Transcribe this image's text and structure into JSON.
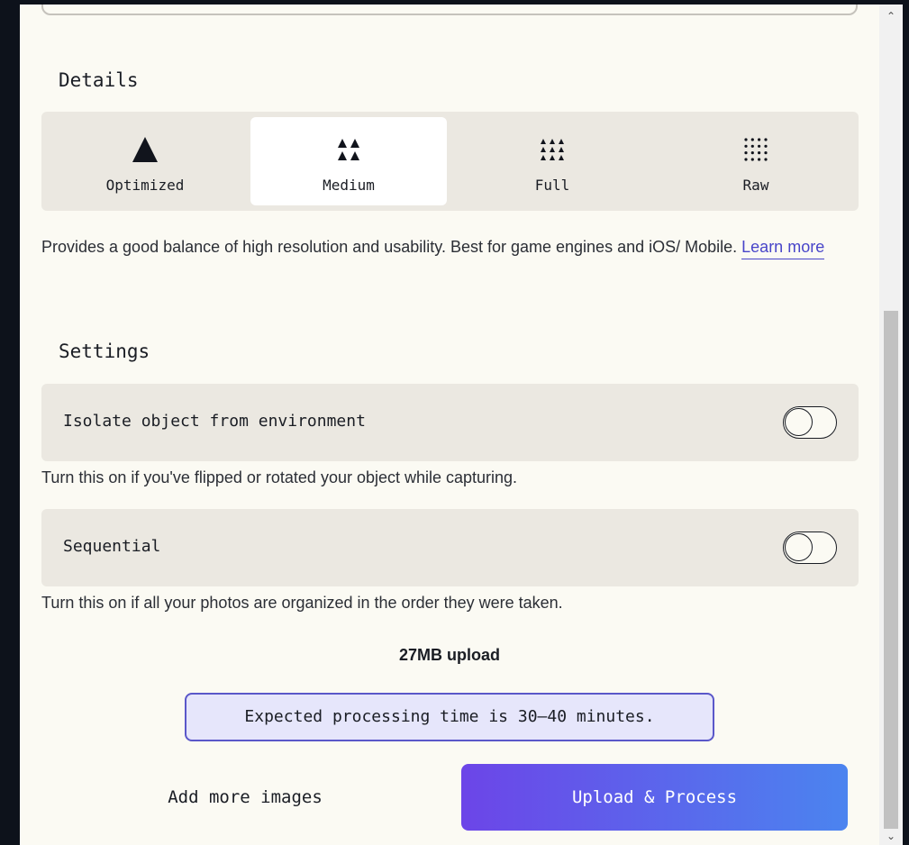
{
  "details": {
    "title": "Details",
    "options": [
      {
        "label": "Optimized",
        "icon": "single-triangle-icon"
      },
      {
        "label": "Medium",
        "icon": "four-triangles-icon"
      },
      {
        "label": "Full",
        "icon": "nine-triangles-icon"
      },
      {
        "label": "Raw",
        "icon": "dot-grid-icon"
      }
    ],
    "selected": "Medium",
    "description": "Provides a good balance of high resolution and usability. Best for game engines and iOS/ Mobile.",
    "learn_more": "Learn more"
  },
  "settings": {
    "title": "Settings",
    "items": [
      {
        "label": "Isolate object from environment",
        "enabled": false,
        "hint": "Turn this on if you've flipped or rotated your object while capturing."
      },
      {
        "label": "Sequential",
        "enabled": false,
        "hint": "Turn this on if all your photos are organized in the order they were taken."
      }
    ]
  },
  "upload_size": "27MB upload",
  "expected_time": "Expected processing time is 30–40 minutes.",
  "actions": {
    "add_more": "Add more images",
    "upload": "Upload & Process"
  },
  "colors": {
    "accent": "#4845c9",
    "button_gradient_start": "#6c45e8",
    "button_gradient_end": "#4b84ef",
    "panel": "#fbfaf3",
    "card": "#ebe8e1"
  }
}
